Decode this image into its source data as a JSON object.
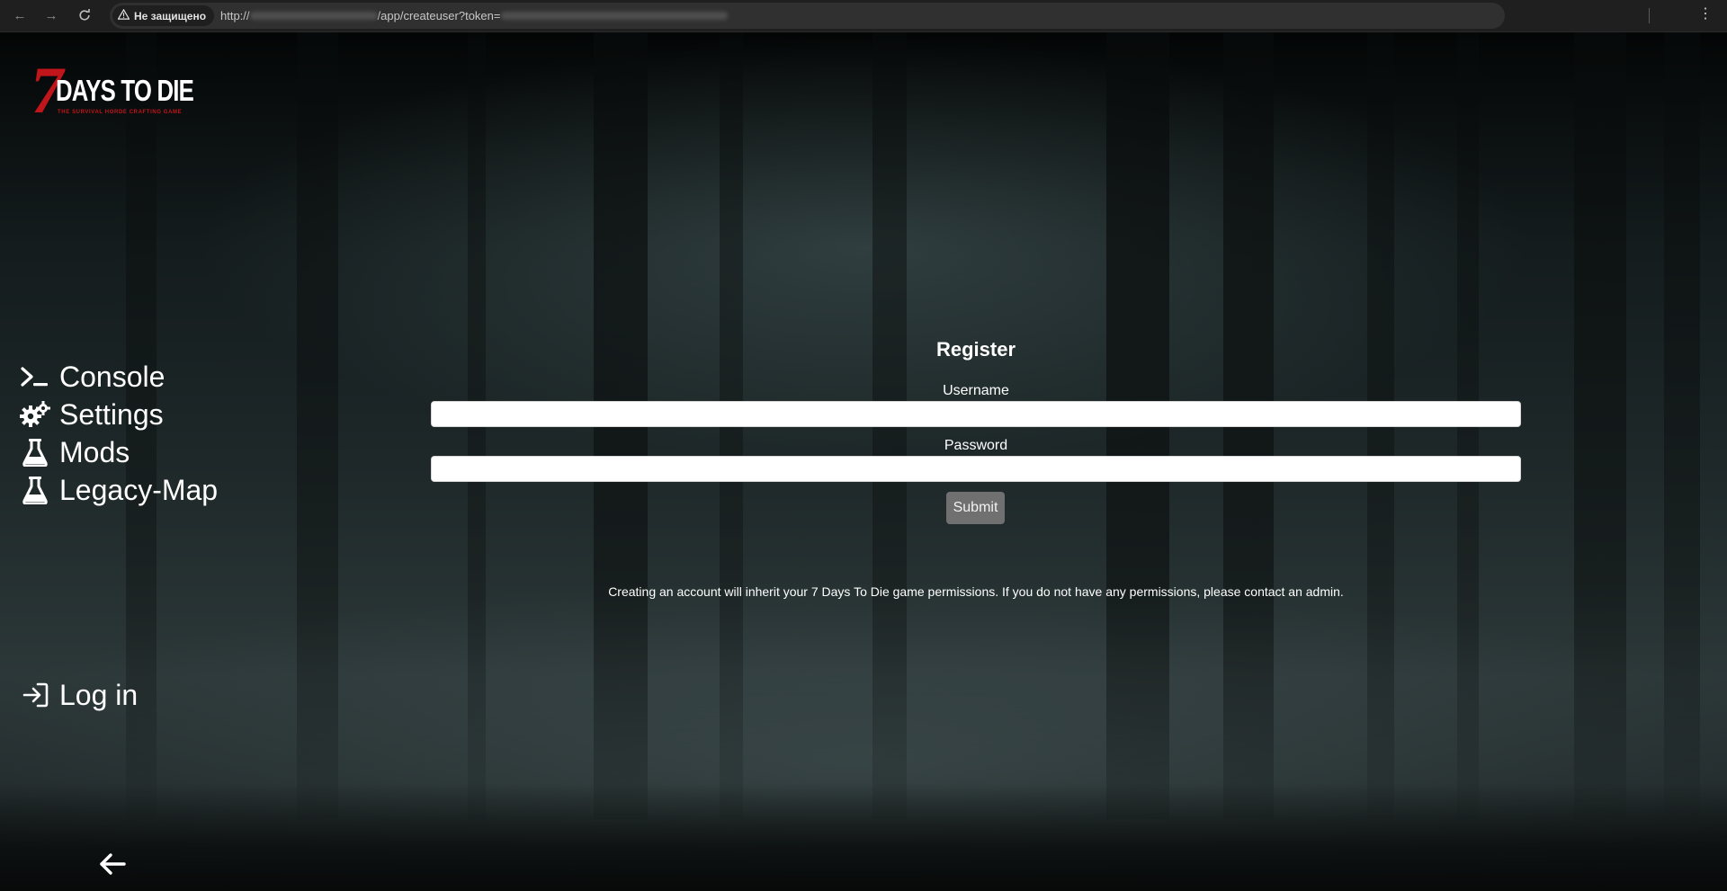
{
  "browser": {
    "security_label": "Не защищено",
    "url_prefix": "http://",
    "url_path": "/app/createuser?token="
  },
  "logo": {
    "seven": "7",
    "title": "DAYS TO DIE",
    "subtitle": "THE SURVIVAL HORDE CRAFTING GAME"
  },
  "sidebar": {
    "items": [
      {
        "label": "Console",
        "icon": "terminal-icon"
      },
      {
        "label": "Settings",
        "icon": "gears-icon"
      },
      {
        "label": "Mods",
        "icon": "flask-icon"
      },
      {
        "label": "Legacy-Map",
        "icon": "flask-icon"
      }
    ],
    "login": {
      "label": "Log in",
      "icon": "sign-in-icon"
    },
    "collapse_icon": "arrow-left-icon"
  },
  "form": {
    "title": "Register",
    "username_label": "Username",
    "username_value": "",
    "password_label": "Password",
    "password_value": "",
    "submit_label": "Submit",
    "info": "Creating an account will inherit your 7 Days To Die game permissions. If you do not have any permissions, please contact an admin."
  },
  "colors": {
    "brand_red": "#c0151a",
    "submit_bg": "#707070"
  }
}
